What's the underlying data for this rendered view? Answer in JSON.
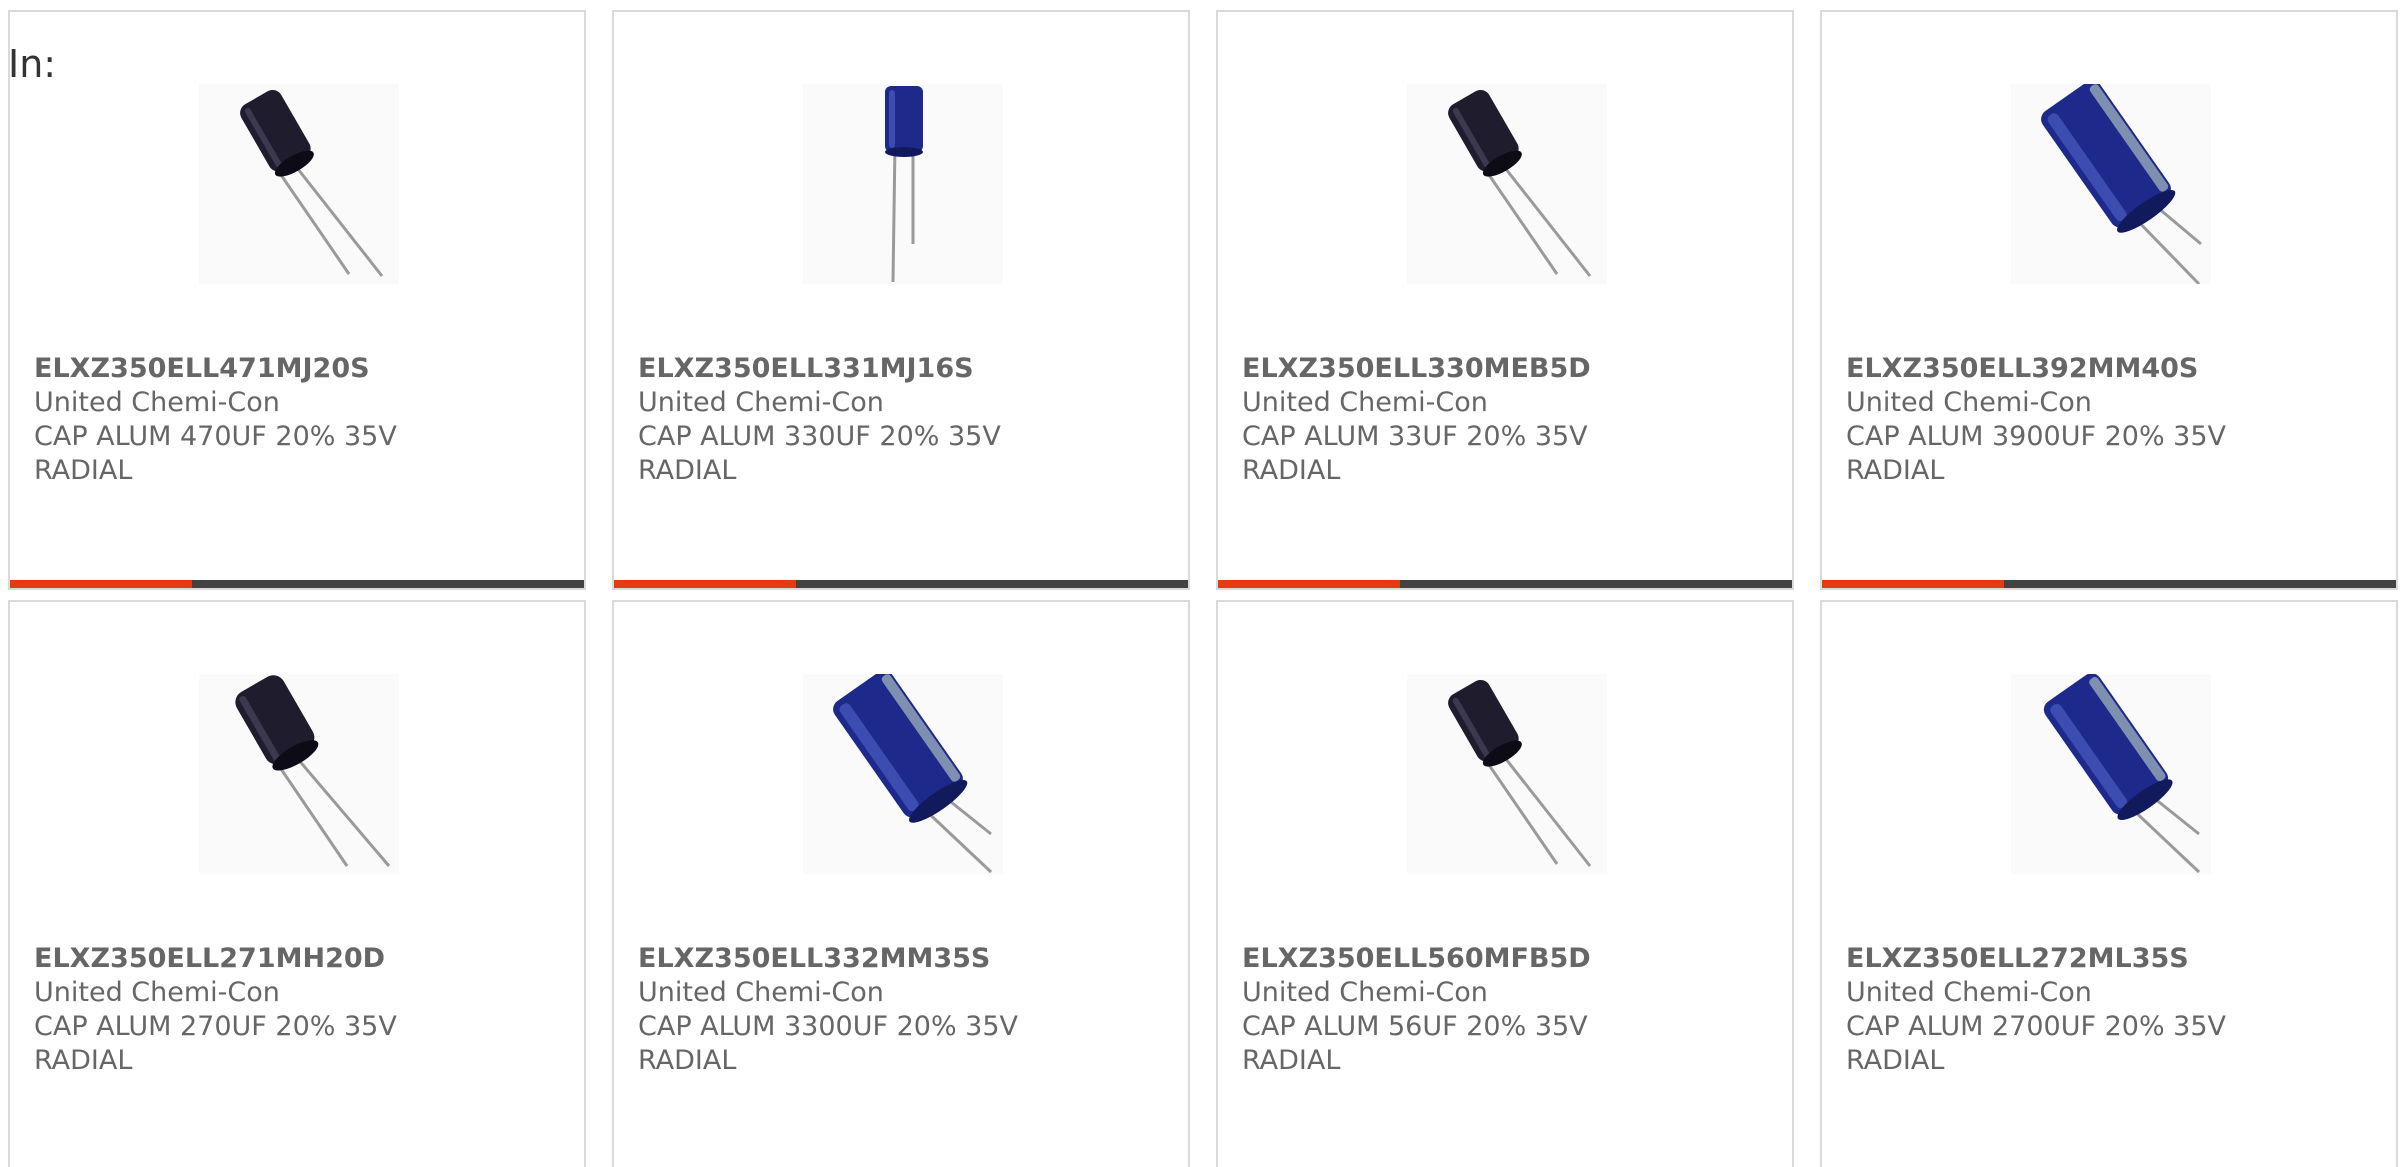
{
  "filter": {
    "label": "In:"
  },
  "colors": {
    "accent": "#e63a12",
    "bar_dark": "#424242",
    "border": "#d9d9d9",
    "text": "#666666",
    "capacitor_black": "#1f1c2e",
    "capacitor_blue": "#1d2a8c"
  },
  "products": [
    {
      "part_number": "ELXZ350ELL471MJ20S",
      "manufacturer": "United Chemi-Con",
      "description": "CAP ALUM 470UF 20% 35V",
      "package": "RADIAL",
      "image_icon": "capacitor-black-icon"
    },
    {
      "part_number": "ELXZ350ELL331MJ16S",
      "manufacturer": "United Chemi-Con",
      "description": "CAP ALUM 330UF 20% 35V",
      "package": "RADIAL",
      "image_icon": "capacitor-blue-upright-icon"
    },
    {
      "part_number": "ELXZ350ELL330MEB5D",
      "manufacturer": "United Chemi-Con",
      "description": "CAP ALUM 33UF 20% 35V",
      "package": "RADIAL",
      "image_icon": "capacitor-black-icon"
    },
    {
      "part_number": "ELXZ350ELL392MM40S",
      "manufacturer": "United Chemi-Con",
      "description": "CAP ALUM 3900UF 20% 35V",
      "package": "RADIAL",
      "image_icon": "capacitor-blue-icon"
    },
    {
      "part_number": "ELXZ350ELL271MH20D",
      "manufacturer": "United Chemi-Con",
      "description": "CAP ALUM 270UF 20% 35V",
      "package": "RADIAL",
      "image_icon": "capacitor-black-icon"
    },
    {
      "part_number": "ELXZ350ELL332MM35S",
      "manufacturer": "United Chemi-Con",
      "description": "CAP ALUM 3300UF 20% 35V",
      "package": "RADIAL",
      "image_icon": "capacitor-blue-icon"
    },
    {
      "part_number": "ELXZ350ELL560MFB5D",
      "manufacturer": "United Chemi-Con",
      "description": "CAP ALUM 56UF 20% 35V",
      "package": "RADIAL",
      "image_icon": "capacitor-black-icon"
    },
    {
      "part_number": "ELXZ350ELL272ML35S",
      "manufacturer": "United Chemi-Con",
      "description": "CAP ALUM 2700UF 20% 35V",
      "package": "RADIAL",
      "image_icon": "capacitor-blue-icon"
    }
  ]
}
